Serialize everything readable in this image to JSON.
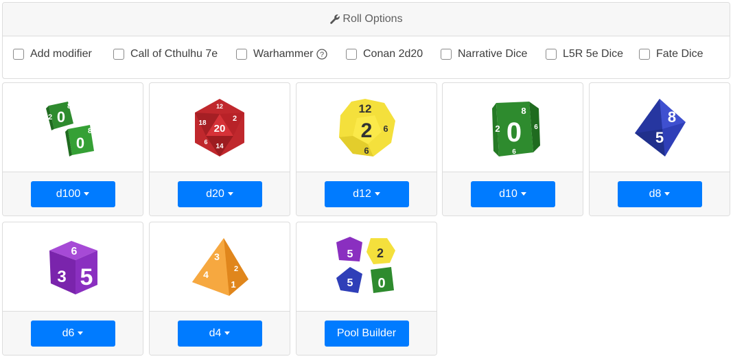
{
  "options": {
    "header": "Roll Options",
    "header_icon": "wrench-icon",
    "checkboxes": [
      {
        "label": "Add modifier",
        "checked": false
      },
      {
        "label": "Call of Cthulhu 7e",
        "checked": false
      },
      {
        "label": "Warhammer",
        "checked": false,
        "help_icon": "question-circle-icon"
      },
      {
        "label": "Conan 2d20",
        "checked": false
      },
      {
        "label": "Narrative Dice",
        "checked": false
      },
      {
        "label": "L5R 5e Dice",
        "checked": false
      },
      {
        "label": "Fate Dice",
        "checked": false
      }
    ]
  },
  "dice": [
    {
      "label": "d100",
      "color": "#2e8b2e",
      "dropdown": true
    },
    {
      "label": "d20",
      "color": "#c0282d",
      "dropdown": true
    },
    {
      "label": "d12",
      "color": "#f4e03c",
      "dropdown": true
    },
    {
      "label": "d10",
      "color": "#2e8b2e",
      "dropdown": true
    },
    {
      "label": "d8",
      "color": "#2f3fb8",
      "dropdown": true
    },
    {
      "label": "d6",
      "color": "#8a2fc0",
      "dropdown": true
    },
    {
      "label": "d4",
      "color": "#f29a2e",
      "dropdown": true
    },
    {
      "label": "Pool Builder",
      "dropdown": false
    }
  ],
  "die_face_numbers": {
    "d100": [
      "0",
      "8",
      "2"
    ],
    "d20": [
      "20",
      "2",
      "12",
      "18",
      "14",
      "6"
    ],
    "d12": [
      "12",
      "2",
      "6"
    ],
    "d10": [
      "0",
      "8",
      "2",
      "6"
    ],
    "d8": [
      "8",
      "5"
    ],
    "d6": [
      "5",
      "6",
      "3"
    ],
    "d4": [
      "3",
      "4",
      "2",
      "1"
    ]
  },
  "colors": {
    "primary": "#007bff",
    "border": "#dcdcdc",
    "panel": "#f7f7f7"
  }
}
